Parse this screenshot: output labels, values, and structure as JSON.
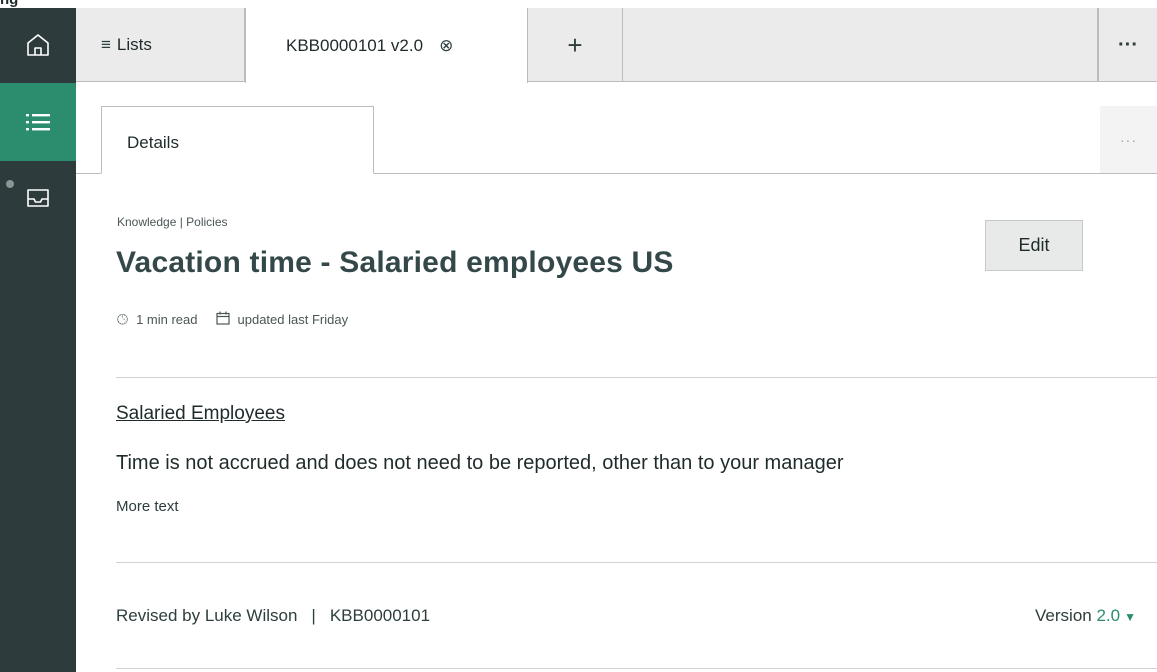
{
  "cropped_fragment": "ng",
  "tabs": {
    "lists_label": "Lists",
    "active_label": "KBB0000101 v2.0",
    "plus": "+",
    "more": "···"
  },
  "details": {
    "tab_label": "Details",
    "more": "···"
  },
  "article": {
    "breadcrumb": "Knowledge | Policies",
    "title": "Vacation time - Salaried employees US",
    "read_time": "1 min read",
    "updated": "updated last Friday",
    "edit_label": "Edit",
    "section_heading": "Salaried Employees",
    "body": "Time is not accrued and does not need to be reported, other than to your manager",
    "more_text": "More text"
  },
  "footer": {
    "revised_by": "Revised by Luke Wilson",
    "separator": "|",
    "article_id": "KBB0000101",
    "version_label": "Version",
    "version_number": "2.0"
  },
  "colors": {
    "rail": "#2e3b3c",
    "accent": "#2c8c6e",
    "title": "#34484a"
  }
}
